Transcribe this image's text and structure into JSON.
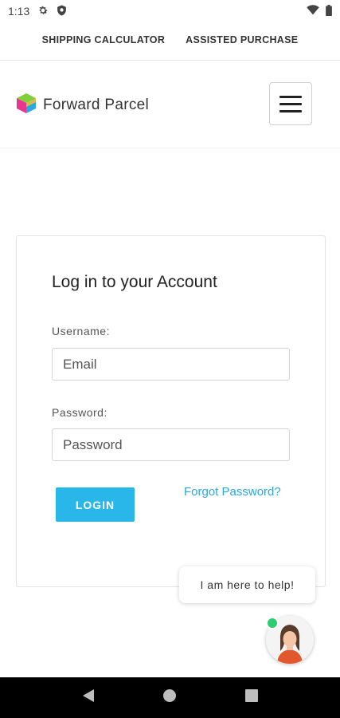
{
  "status_bar": {
    "time": "1:13"
  },
  "top_links": {
    "shipping_calculator": "SHIPPING CALCULATOR",
    "assisted_purchase": "ASSISTED PURCHASE"
  },
  "header": {
    "brand_name": "Forward Parcel"
  },
  "login": {
    "title": "Log in to your Account",
    "username_label": "Username:",
    "email_placeholder": "Email",
    "password_label": "Password:",
    "password_placeholder": "Password",
    "login_button": "LOGIN",
    "forgot_password": "Forgot Password?"
  },
  "chat": {
    "message": "I am here to help!"
  },
  "colors": {
    "accent": "#29b6e8",
    "link": "#29a8de",
    "online": "#2ecc71"
  }
}
